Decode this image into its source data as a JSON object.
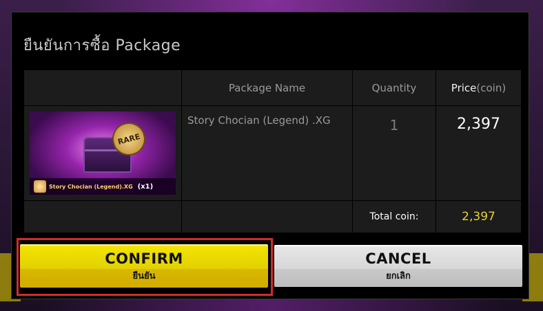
{
  "dialog": {
    "title": "ยืนยันการซื้อ Package"
  },
  "table": {
    "headers": {
      "package_name": "Package Name",
      "quantity": "Quantity",
      "price_main": "Price",
      "price_sub": "(coin)"
    },
    "row": {
      "thumbnail_badge": "RARE",
      "thumbnail_caption": "Story Chocian (Legend).XG",
      "thumbnail_qty": "(x1)",
      "package_name": "Story Chocian (Legend) .XG",
      "quantity": "1",
      "price": "2,397"
    },
    "total": {
      "label": "Total coin:",
      "value": "2,397"
    }
  },
  "buttons": {
    "confirm_label": "CONFIRM",
    "confirm_sub": "ยืนยัน",
    "cancel_label": "CANCEL",
    "cancel_sub": "ยกเลิก"
  },
  "colors": {
    "confirm": "#e8d800",
    "cancel": "#d6d6d6",
    "highlight_frame": "#d42a2a",
    "total_value": "#e8d233"
  },
  "icons": {
    "chest": "treasure-chest-icon",
    "rare": "rare-badge-icon"
  }
}
